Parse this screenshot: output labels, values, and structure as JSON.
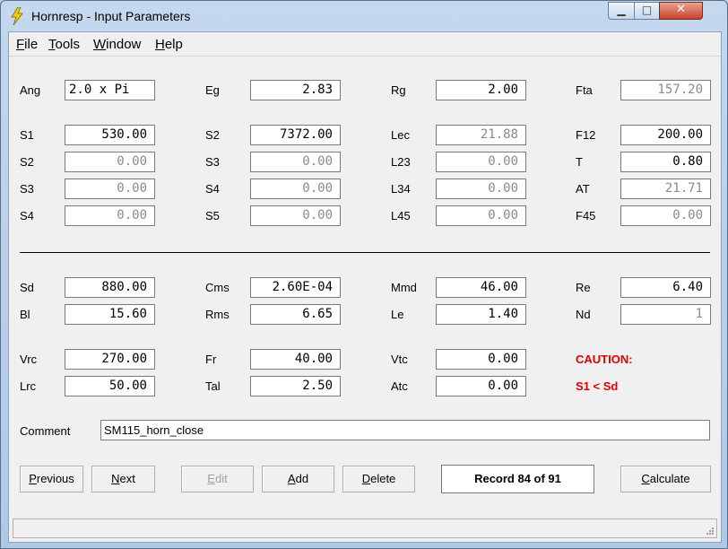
{
  "window": {
    "title": "Hornresp - Input Parameters"
  },
  "menu": [
    {
      "key": "F",
      "rest": "ile"
    },
    {
      "key": "T",
      "rest": "ools"
    },
    {
      "key": "W",
      "rest": "indow"
    },
    {
      "key": "H",
      "rest": "elp"
    }
  ],
  "params": {
    "ang": {
      "label": "Ang",
      "value": "2.0 x Pi"
    },
    "eg": {
      "label": "Eg",
      "value": "2.83"
    },
    "rg": {
      "label": "Rg",
      "value": "2.00"
    },
    "fta": {
      "label": "Fta",
      "value": "157.20"
    },
    "s1": {
      "label": "S1",
      "value": "530.00"
    },
    "s2a": {
      "label": "S2",
      "value": "7372.00"
    },
    "lec": {
      "label": "Lec",
      "value": "21.88"
    },
    "f12": {
      "label": "F12",
      "value": "200.00"
    },
    "s2b": {
      "label": "S2",
      "value": "0.00"
    },
    "s3a": {
      "label": "S3",
      "value": "0.00"
    },
    "l23": {
      "label": "L23",
      "value": "0.00"
    },
    "t": {
      "label": "T",
      "value": "0.80"
    },
    "s3b": {
      "label": "S3",
      "value": "0.00"
    },
    "s4a": {
      "label": "S4",
      "value": "0.00"
    },
    "l34": {
      "label": "L34",
      "value": "0.00"
    },
    "at": {
      "label": "AT",
      "value": "21.71"
    },
    "s4b": {
      "label": "S4",
      "value": "0.00"
    },
    "s5": {
      "label": "S5",
      "value": "0.00"
    },
    "l45": {
      "label": "L45",
      "value": "0.00"
    },
    "f45": {
      "label": "F45",
      "value": "0.00"
    },
    "sd": {
      "label": "Sd",
      "value": "880.00"
    },
    "cms": {
      "label": "Cms",
      "value": "2.60E-04"
    },
    "mmd": {
      "label": "Mmd",
      "value": "46.00"
    },
    "re": {
      "label": "Re",
      "value": "6.40"
    },
    "bl": {
      "label": "Bl",
      "value": "15.60"
    },
    "rms": {
      "label": "Rms",
      "value": "6.65"
    },
    "le": {
      "label": "Le",
      "value": "1.40"
    },
    "nd": {
      "label": "Nd",
      "value": "1"
    },
    "vrc": {
      "label": "Vrc",
      "value": "270.00"
    },
    "fr": {
      "label": "Fr",
      "value": "40.00"
    },
    "vtc": {
      "label": "Vtc",
      "value": "0.00"
    },
    "lrc": {
      "label": "Lrc",
      "value": "50.00"
    },
    "tal": {
      "label": "Tal",
      "value": "2.50"
    },
    "atc": {
      "label": "Atc",
      "value": "0.00"
    }
  },
  "caution": {
    "title": "CAUTION:",
    "message": "S1 < Sd"
  },
  "comment": {
    "label": "Comment",
    "value": "SM115_horn_close"
  },
  "buttons": {
    "previous": {
      "key": "P",
      "rest": "revious"
    },
    "next": {
      "key": "N",
      "rest": "ext"
    },
    "edit": {
      "key": "E",
      "rest": "dit"
    },
    "add": {
      "key": "A",
      "rest": "dd"
    },
    "delete": {
      "key": "D",
      "rest": "elete"
    },
    "calculate": {
      "key": "C",
      "rest": "alculate"
    }
  },
  "record": "Record 84 of 91",
  "colors": {
    "caution": "#e00000",
    "readonly": "#8a8a8a"
  }
}
